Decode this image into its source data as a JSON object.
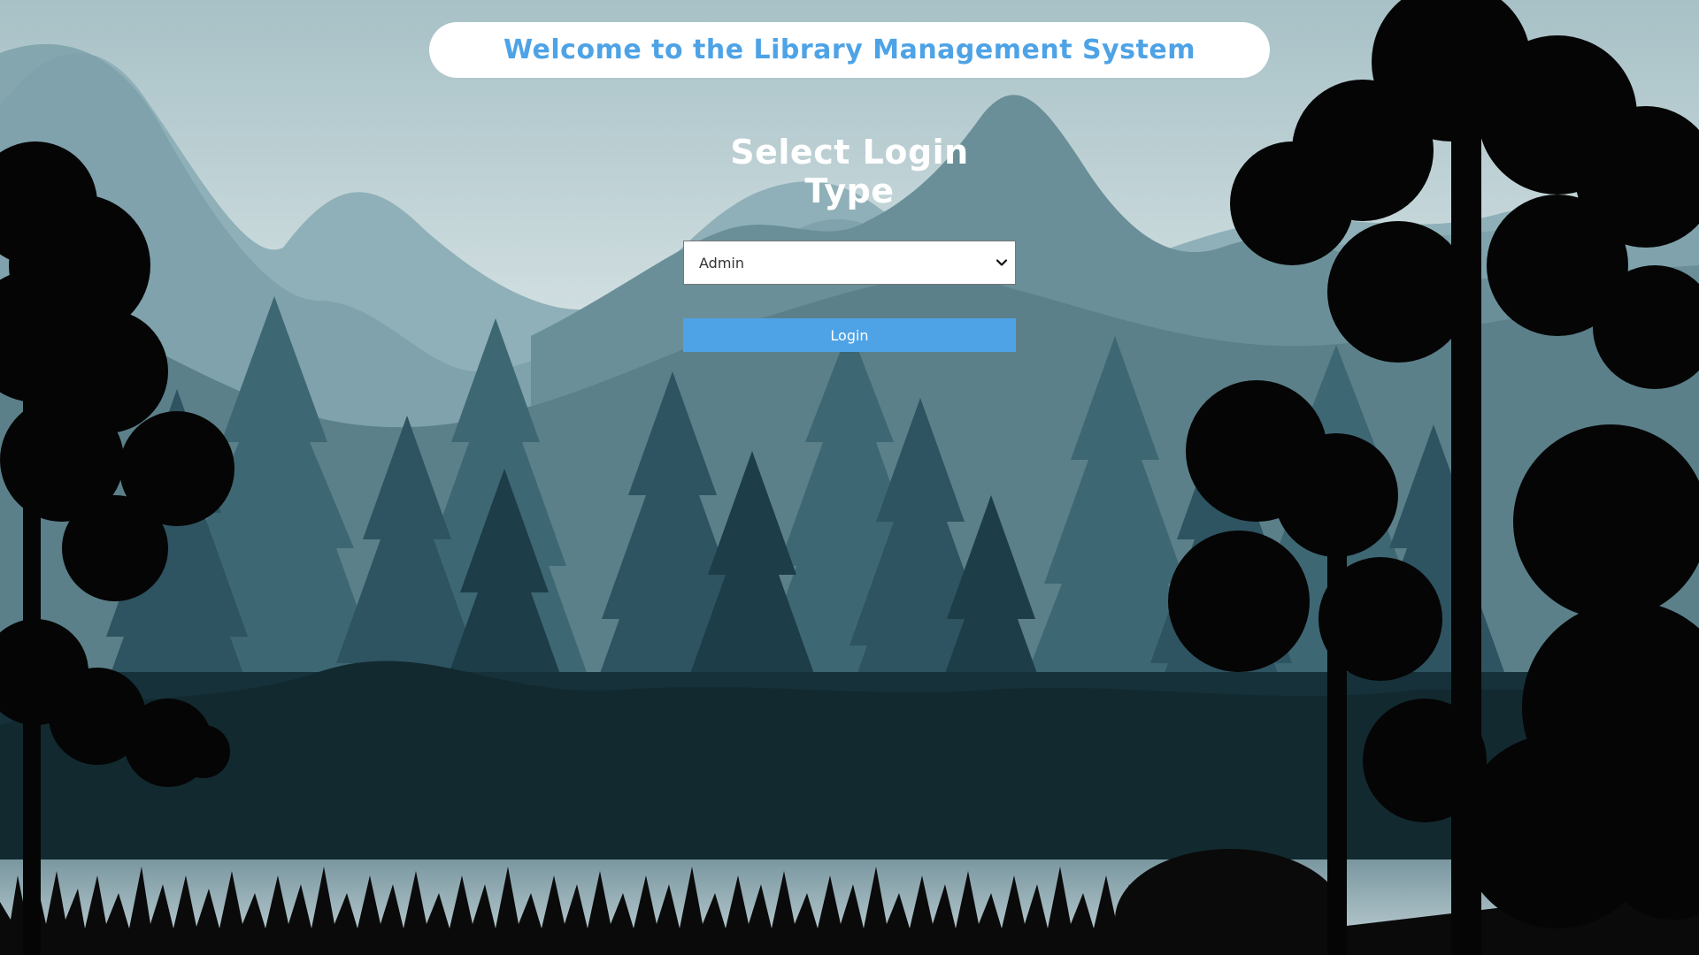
{
  "header": {
    "title": "Welcome to the Library Management System"
  },
  "login": {
    "heading": "Select Login Type",
    "select": {
      "selected": "Admin",
      "options": [
        "Admin"
      ]
    },
    "button_label": "Login"
  },
  "icons": {
    "select_chevron": "chevron-down-icon"
  },
  "colors": {
    "accent": "#4ea3e6",
    "header_background": "#ffffff",
    "heading_text": "#ffffff"
  }
}
